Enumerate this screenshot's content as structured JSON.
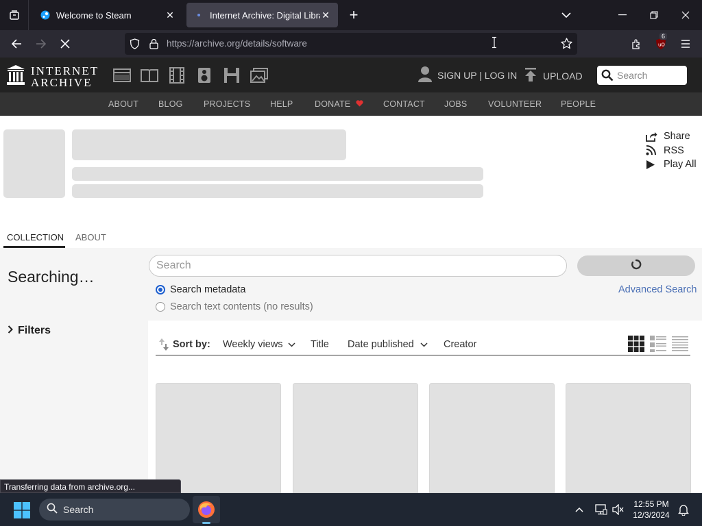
{
  "browser": {
    "tabs": [
      {
        "title": "Welcome to Steam",
        "active": false,
        "favicon": "steam-icon"
      },
      {
        "title": "Internet Archive: Digital Library",
        "active": true,
        "favicon": "loading-dot-icon"
      }
    ],
    "url_host": "https://archive.org",
    "url_path": "/details/software",
    "extension_badge": "6"
  },
  "ia": {
    "logo_line1": "INTERNET",
    "logo_line2": "ARCHIVE",
    "media_icons": [
      "web-icon",
      "texts-icon",
      "video-icon",
      "audio-icon",
      "software-icon",
      "images-icon"
    ],
    "sign_up_login": "SIGN UP | LOG IN",
    "upload": "UPLOAD",
    "search_placeholder": "Search",
    "subnav": [
      "ABOUT",
      "BLOG",
      "PROJECTS",
      "HELP",
      "DONATE",
      "CONTACT",
      "JOBS",
      "VOLUNTEER",
      "PEOPLE"
    ]
  },
  "page": {
    "actions": [
      "Share",
      "RSS",
      "Play All"
    ],
    "tabs": [
      "COLLECTION",
      "ABOUT"
    ],
    "searching": "Searching…",
    "filters": "Filters",
    "search_placeholder": "Search",
    "radio_metadata": "Search metadata",
    "radio_text": "Search text contents (no results)",
    "advanced_search": "Advanced Search",
    "sort_label": "Sort by:",
    "sort_options": [
      "Weekly views",
      "Title",
      "Date published",
      "Creator"
    ]
  },
  "status_text": "Transferring data from archive.org...",
  "taskbar": {
    "search": "Search",
    "time": "12:55 PM",
    "date": "12/3/2024"
  },
  "colors": {
    "accent_blue": "#1d5fcf",
    "link_blue": "#4a6fb5",
    "donate_heart": "#e03131"
  }
}
